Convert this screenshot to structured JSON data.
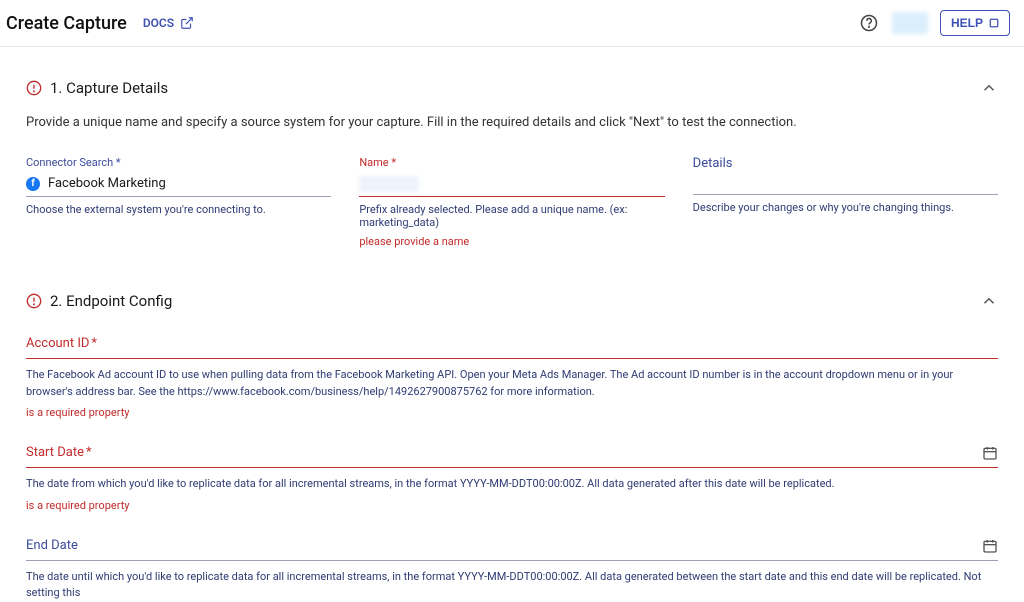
{
  "header": {
    "title": "Create Capture",
    "docs_label": "DOCS",
    "help_label": "HELP"
  },
  "section1": {
    "title": "1. Capture Details",
    "description": "Provide a unique name and specify a source system for your capture. Fill in the required details and click \"Next\" to test the connection.",
    "connector": {
      "label": "Connector Search *",
      "value": "Facebook Marketing",
      "helper": "Choose the external system you're connecting to."
    },
    "name": {
      "label": "Name *",
      "helper": "Prefix already selected. Please add a unique name. (ex: marketing_data)",
      "error": "please provide a name"
    },
    "details": {
      "label": "Details",
      "helper": "Describe your changes or why you're changing things."
    }
  },
  "section2": {
    "title": "2. Endpoint Config",
    "account_id": {
      "label": "Account ID",
      "helper": "The Facebook Ad account ID to use when pulling data from the Facebook Marketing API. Open your Meta Ads Manager. The Ad account ID number is in the account dropdown menu or in your browser's address bar. See the https://www.facebook.com/business/help/1492627900875762 for more information.",
      "error": "is a required property"
    },
    "start_date": {
      "label": "Start Date",
      "helper": "The date from which you'd like to replicate data for all incremental streams, in the format YYYY-MM-DDT00:00:00Z. All data generated after this date will be replicated.",
      "error": "is a required property"
    },
    "end_date": {
      "label": "End Date",
      "helper": "The date until which you'd like to replicate data for all incremental streams, in the format YYYY-MM-DDT00:00:00Z. All data generated between the start date and this end date will be replicated. Not setting this"
    }
  }
}
